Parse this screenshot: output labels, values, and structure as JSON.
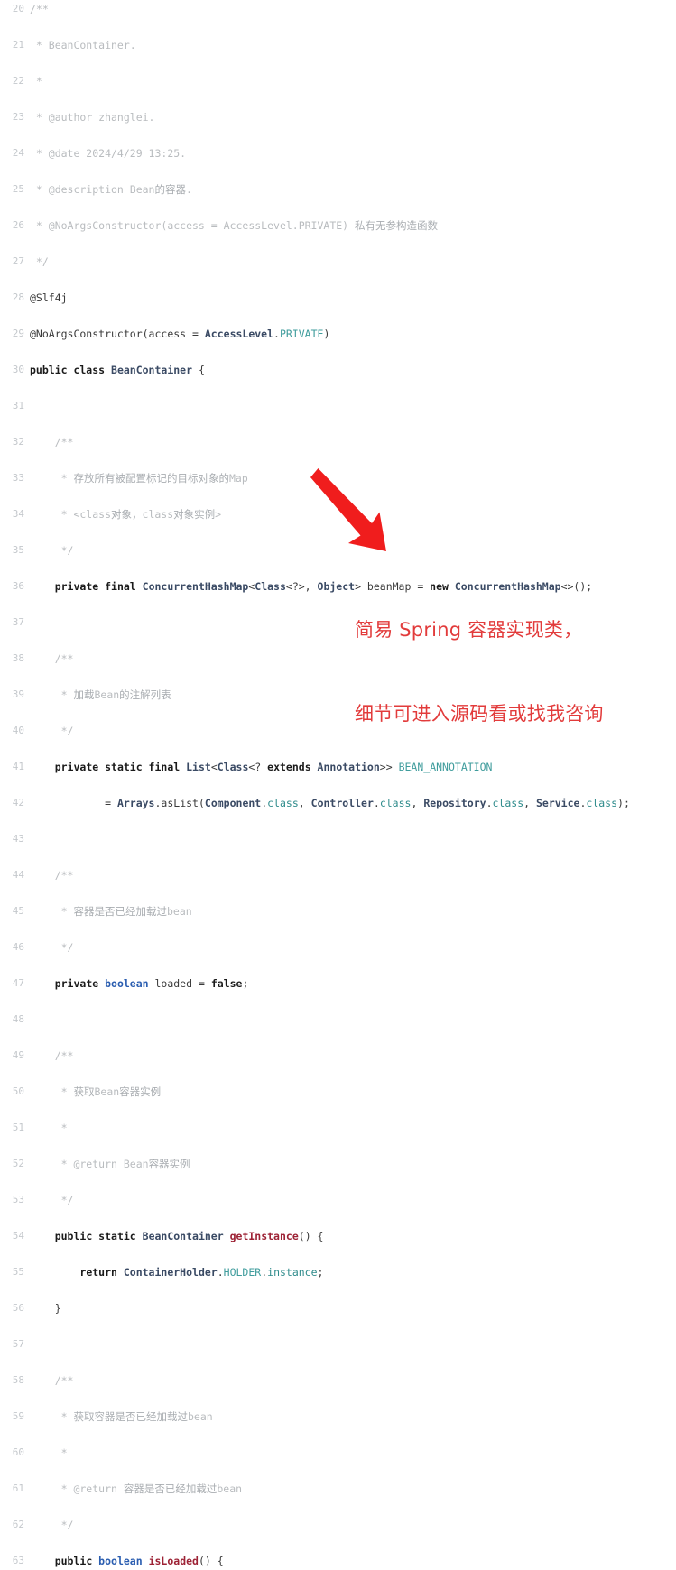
{
  "editor": {
    "background": "#ffffff",
    "gutter_color": "#c4c8cc",
    "language": "Java",
    "first_line_number": 20,
    "last_line_number": 63,
    "lines": [
      {
        "num": "20",
        "text": "/**",
        "segments": [
          {
            "t": "/**",
            "c": "t-cmt"
          }
        ]
      },
      {
        "num": "21",
        "text": " * BeanContainer.",
        "segments": [
          {
            "t": " * BeanContainer.",
            "c": "t-cmt"
          }
        ]
      },
      {
        "num": "22",
        "text": " *",
        "segments": [
          {
            "t": " *",
            "c": "t-cmt"
          }
        ]
      },
      {
        "num": "23",
        "text": " * @author zhanglei.",
        "segments": [
          {
            "t": " * @author zhanglei.",
            "c": "t-cmt"
          }
        ]
      },
      {
        "num": "24",
        "text": " * @date 2024/4/29 13:25.",
        "segments": [
          {
            "t": " * @date 2024/4/29 13:25.",
            "c": "t-cmt"
          }
        ]
      },
      {
        "num": "25",
        "text": " * @description Bean的容器.",
        "segments": [
          {
            "t": " * @description Bean",
            "c": "t-cmt"
          },
          {
            "t": "的容器",
            "c": "t-cmt-cn"
          },
          {
            "t": ".",
            "c": "t-cmt"
          }
        ]
      },
      {
        "num": "26",
        "text": " * @NoArgsConstructor(access = AccessLevel.PRIVATE) 私有无参构造函数",
        "segments": [
          {
            "t": " * @NoArgsConstructor(access = AccessLevel.PRIVATE) ",
            "c": "t-cmt"
          },
          {
            "t": "私有无参构造函数",
            "c": "t-cmt-cn"
          }
        ]
      },
      {
        "num": "27",
        "text": " */",
        "segments": [
          {
            "t": " */",
            "c": "t-cmt"
          }
        ]
      },
      {
        "num": "28",
        "text": "@Slf4j",
        "segments": [
          {
            "t": "@Slf4j",
            "c": "t-anno"
          }
        ]
      },
      {
        "num": "29",
        "text": "@NoArgsConstructor(access = AccessLevel.PRIVATE)",
        "segments": [
          {
            "t": "@NoArgsConstructor(access = ",
            "c": "t-anno"
          },
          {
            "t": "AccessLevel",
            "c": "t-type"
          },
          {
            "t": ".",
            "c": "t-punct"
          },
          {
            "t": "PRIVATE",
            "c": "t-const"
          },
          {
            "t": ")",
            "c": "t-punct"
          }
        ]
      },
      {
        "num": "30",
        "text": "public class BeanContainer {",
        "segments": [
          {
            "t": "public class ",
            "c": "t-kw"
          },
          {
            "t": "BeanContainer",
            "c": "t-type"
          },
          {
            "t": " {",
            "c": "t-punct"
          }
        ]
      },
      {
        "num": "31",
        "text": "",
        "segments": []
      },
      {
        "num": "32",
        "text": "    /**",
        "segments": [
          {
            "t": "    /**",
            "c": "t-cmt"
          }
        ]
      },
      {
        "num": "33",
        "text": "     * 存放所有被配置标记的目标对象的Map",
        "segments": [
          {
            "t": "     * ",
            "c": "t-cmt"
          },
          {
            "t": "存放所有被配置标记的目标对象的",
            "c": "t-cmt-cn"
          },
          {
            "t": "Map",
            "c": "t-cmt"
          }
        ]
      },
      {
        "num": "34",
        "text": "     * <class对象，class对象实例>",
        "segments": [
          {
            "t": "     * <class",
            "c": "t-cmt"
          },
          {
            "t": "对象，",
            "c": "t-cmt-cn"
          },
          {
            "t": "class",
            "c": "t-cmt"
          },
          {
            "t": "对象实例",
            "c": "t-cmt-cn"
          },
          {
            "t": ">",
            "c": "t-cmt"
          }
        ]
      },
      {
        "num": "35",
        "text": "     */",
        "segments": [
          {
            "t": "     */",
            "c": "t-cmt"
          }
        ]
      },
      {
        "num": "36",
        "text": "    private final ConcurrentHashMap<Class<?>, Object> beanMap = new ConcurrentHashMap<>();",
        "segments": [
          {
            "t": "    ",
            "c": "t-plain"
          },
          {
            "t": "private final ",
            "c": "t-kw"
          },
          {
            "t": "ConcurrentHashMap",
            "c": "t-type"
          },
          {
            "t": "<",
            "c": "t-punct"
          },
          {
            "t": "Class",
            "c": "t-type"
          },
          {
            "t": "<?>, ",
            "c": "t-punct"
          },
          {
            "t": "Object",
            "c": "t-type"
          },
          {
            "t": "> beanMap = ",
            "c": "t-plain"
          },
          {
            "t": "new ",
            "c": "t-kw"
          },
          {
            "t": "ConcurrentHashMap",
            "c": "t-type"
          },
          {
            "t": "<>();",
            "c": "t-punct"
          }
        ]
      },
      {
        "num": "37",
        "text": "",
        "segments": []
      },
      {
        "num": "38",
        "text": "    /**",
        "segments": [
          {
            "t": "    /**",
            "c": "t-cmt"
          }
        ]
      },
      {
        "num": "39",
        "text": "     * 加载Bean的注解列表",
        "segments": [
          {
            "t": "     * ",
            "c": "t-cmt"
          },
          {
            "t": "加载",
            "c": "t-cmt-cn"
          },
          {
            "t": "Bean",
            "c": "t-cmt"
          },
          {
            "t": "的注解列表",
            "c": "t-cmt-cn"
          }
        ]
      },
      {
        "num": "40",
        "text": "     */",
        "segments": [
          {
            "t": "     */",
            "c": "t-cmt"
          }
        ]
      },
      {
        "num": "41",
        "text": "    private static final List<Class<? extends Annotation>> BEAN_ANNOTATION",
        "segments": [
          {
            "t": "    ",
            "c": "t-plain"
          },
          {
            "t": "private static final ",
            "c": "t-kw"
          },
          {
            "t": "List",
            "c": "t-type"
          },
          {
            "t": "<",
            "c": "t-punct"
          },
          {
            "t": "Class",
            "c": "t-type"
          },
          {
            "t": "<? ",
            "c": "t-punct"
          },
          {
            "t": "extends ",
            "c": "t-kw"
          },
          {
            "t": "Annotation",
            "c": "t-type"
          },
          {
            "t": ">> ",
            "c": "t-punct"
          },
          {
            "t": "BEAN_ANNOTATION",
            "c": "t-const"
          }
        ]
      },
      {
        "num": "42",
        "text": "            = Arrays.asList(Component.class, Controller.class, Repository.class, Service.class);",
        "segments": [
          {
            "t": "            = ",
            "c": "t-plain"
          },
          {
            "t": "Arrays",
            "c": "t-type"
          },
          {
            "t": ".",
            "c": "t-punct"
          },
          {
            "t": "asList",
            "c": "t-plain"
          },
          {
            "t": "(",
            "c": "t-punct"
          },
          {
            "t": "Component",
            "c": "t-type"
          },
          {
            "t": ".",
            "c": "t-punct"
          },
          {
            "t": "class",
            "c": "t-static"
          },
          {
            "t": ", ",
            "c": "t-punct"
          },
          {
            "t": "Controller",
            "c": "t-type"
          },
          {
            "t": ".",
            "c": "t-punct"
          },
          {
            "t": "class",
            "c": "t-static"
          },
          {
            "t": ", ",
            "c": "t-punct"
          },
          {
            "t": "Repository",
            "c": "t-type"
          },
          {
            "t": ".",
            "c": "t-punct"
          },
          {
            "t": "class",
            "c": "t-static"
          },
          {
            "t": ", ",
            "c": "t-punct"
          },
          {
            "t": "Service",
            "c": "t-type"
          },
          {
            "t": ".",
            "c": "t-punct"
          },
          {
            "t": "class",
            "c": "t-static"
          },
          {
            "t": ");",
            "c": "t-punct"
          }
        ]
      },
      {
        "num": "43",
        "text": "",
        "segments": []
      },
      {
        "num": "44",
        "text": "    /**",
        "segments": [
          {
            "t": "    /**",
            "c": "t-cmt"
          }
        ]
      },
      {
        "num": "45",
        "text": "     * 容器是否已经加载过bean",
        "segments": [
          {
            "t": "     * ",
            "c": "t-cmt"
          },
          {
            "t": "容器是否已经加载过",
            "c": "t-cmt-cn"
          },
          {
            "t": "bean",
            "c": "t-cmt"
          }
        ]
      },
      {
        "num": "46",
        "text": "     */",
        "segments": [
          {
            "t": "     */",
            "c": "t-cmt"
          }
        ]
      },
      {
        "num": "47",
        "text": "    private boolean loaded = false;",
        "segments": [
          {
            "t": "    ",
            "c": "t-plain"
          },
          {
            "t": "private ",
            "c": "t-kw"
          },
          {
            "t": "boolean",
            "c": "t-kw-b"
          },
          {
            "t": " loaded = ",
            "c": "t-plain"
          },
          {
            "t": "false",
            "c": "t-kw"
          },
          {
            "t": ";",
            "c": "t-punct"
          }
        ]
      },
      {
        "num": "48",
        "text": "",
        "segments": []
      },
      {
        "num": "49",
        "text": "    /**",
        "segments": [
          {
            "t": "    /**",
            "c": "t-cmt"
          }
        ]
      },
      {
        "num": "50",
        "text": "     * 获取Bean容器实例",
        "segments": [
          {
            "t": "     * ",
            "c": "t-cmt"
          },
          {
            "t": "获取",
            "c": "t-cmt-cn"
          },
          {
            "t": "Bean",
            "c": "t-cmt"
          },
          {
            "t": "容器实例",
            "c": "t-cmt-cn"
          }
        ]
      },
      {
        "num": "51",
        "text": "     *",
        "segments": [
          {
            "t": "     *",
            "c": "t-cmt"
          }
        ]
      },
      {
        "num": "52",
        "text": "     * @return Bean容器实例",
        "segments": [
          {
            "t": "     * @return Bean",
            "c": "t-cmt"
          },
          {
            "t": "容器实例",
            "c": "t-cmt-cn"
          }
        ]
      },
      {
        "num": "53",
        "text": "     */",
        "segments": [
          {
            "t": "     */",
            "c": "t-cmt"
          }
        ]
      },
      {
        "num": "54",
        "text": "    public static BeanContainer getInstance() {",
        "segments": [
          {
            "t": "    ",
            "c": "t-plain"
          },
          {
            "t": "public static ",
            "c": "t-kw"
          },
          {
            "t": "BeanContainer",
            "c": "t-type"
          },
          {
            "t": " ",
            "c": "t-plain"
          },
          {
            "t": "getInstance",
            "c": "t-meth"
          },
          {
            "t": "() {",
            "c": "t-punct"
          }
        ]
      },
      {
        "num": "55",
        "text": "        return ContainerHolder.HOLDER.instance;",
        "segments": [
          {
            "t": "        ",
            "c": "t-plain"
          },
          {
            "t": "return ",
            "c": "t-kw"
          },
          {
            "t": "ContainerHolder",
            "c": "t-type"
          },
          {
            "t": ".",
            "c": "t-punct"
          },
          {
            "t": "HOLDER",
            "c": "t-const"
          },
          {
            "t": ".",
            "c": "t-punct"
          },
          {
            "t": "instance",
            "c": "t-static"
          },
          {
            "t": ";",
            "c": "t-punct"
          }
        ]
      },
      {
        "num": "56",
        "text": "    }",
        "segments": [
          {
            "t": "    }",
            "c": "t-punct"
          }
        ]
      },
      {
        "num": "57",
        "text": "",
        "segments": []
      },
      {
        "num": "58",
        "text": "    /**",
        "segments": [
          {
            "t": "    /**",
            "c": "t-cmt"
          }
        ]
      },
      {
        "num": "59",
        "text": "     * 获取容器是否已经加载过bean",
        "segments": [
          {
            "t": "     * ",
            "c": "t-cmt"
          },
          {
            "t": "获取容器是否已经加载过",
            "c": "t-cmt-cn"
          },
          {
            "t": "bean",
            "c": "t-cmt"
          }
        ]
      },
      {
        "num": "60",
        "text": "     *",
        "segments": [
          {
            "t": "     *",
            "c": "t-cmt"
          }
        ]
      },
      {
        "num": "61",
        "text": "     * @return 容器是否已经加载过bean",
        "segments": [
          {
            "t": "     * @return ",
            "c": "t-cmt"
          },
          {
            "t": "容器是否已经加载过",
            "c": "t-cmt-cn"
          },
          {
            "t": "bean",
            "c": "t-cmt"
          }
        ]
      },
      {
        "num": "62",
        "text": "     */",
        "segments": [
          {
            "t": "     */",
            "c": "t-cmt"
          }
        ]
      },
      {
        "num": "63",
        "text": "    public boolean isLoaded() {",
        "segments": [
          {
            "t": "    ",
            "c": "t-plain"
          },
          {
            "t": "public ",
            "c": "t-kw"
          },
          {
            "t": "boolean",
            "c": "t-kw-b"
          },
          {
            "t": " ",
            "c": "t-plain"
          },
          {
            "t": "isLoaded",
            "c": "t-meth"
          },
          {
            "t": "() {",
            "c": "t-punct"
          }
        ]
      }
    ]
  },
  "annotation": {
    "color": "#e23b3b",
    "arrow_name": "red-arrow-pointing-down-right",
    "line1": "简易 Spring 容器实现类，",
    "line2": "细节可进入源码看或找我咨询"
  }
}
